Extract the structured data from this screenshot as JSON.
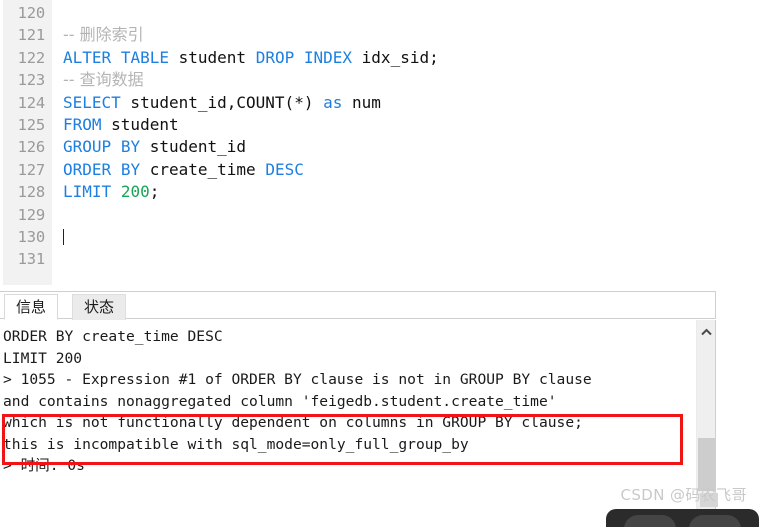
{
  "app": {
    "kind": "sql-client-query-window",
    "watermark": "CSDN @码农飞哥"
  },
  "editor": {
    "first_line_number": 120,
    "cursor_line": 130,
    "line_numbers": [
      "120",
      "121",
      "122",
      "123",
      "124",
      "125",
      "126",
      "127",
      "128",
      "129",
      "130",
      "131"
    ],
    "lines": [
      {
        "n": "120",
        "tokens": []
      },
      {
        "n": "121",
        "tokens": [
          {
            "t": "-- 删除索引",
            "c": "cmt"
          }
        ]
      },
      {
        "n": "122",
        "tokens": [
          {
            "t": "ALTER",
            "c": "kw"
          },
          {
            "t": " ",
            "c": "pln"
          },
          {
            "t": "TABLE",
            "c": "kw"
          },
          {
            "t": " student ",
            "c": "pln"
          },
          {
            "t": "DROP",
            "c": "kw"
          },
          {
            "t": " ",
            "c": "pln"
          },
          {
            "t": "INDEX",
            "c": "kw"
          },
          {
            "t": " idx_sid;",
            "c": "pln"
          }
        ]
      },
      {
        "n": "123",
        "tokens": [
          {
            "t": "-- 查询数据",
            "c": "cmt"
          }
        ]
      },
      {
        "n": "124",
        "tokens": [
          {
            "t": "SELECT",
            "c": "kw"
          },
          {
            "t": " student_id,COUNT(*) ",
            "c": "pln"
          },
          {
            "t": "as",
            "c": "kw"
          },
          {
            "t": " num",
            "c": "pln"
          }
        ]
      },
      {
        "n": "125",
        "tokens": [
          {
            "t": "FROM",
            "c": "kw"
          },
          {
            "t": " student",
            "c": "pln"
          }
        ]
      },
      {
        "n": "126",
        "tokens": [
          {
            "t": "GROUP",
            "c": "kw"
          },
          {
            "t": " ",
            "c": "pln"
          },
          {
            "t": "BY",
            "c": "kw"
          },
          {
            "t": " student_id",
            "c": "pln"
          }
        ]
      },
      {
        "n": "127",
        "tokens": [
          {
            "t": "ORDER",
            "c": "kw"
          },
          {
            "t": " ",
            "c": "pln"
          },
          {
            "t": "BY",
            "c": "kw"
          },
          {
            "t": " create_time ",
            "c": "pln"
          },
          {
            "t": "DESC",
            "c": "kw"
          }
        ]
      },
      {
        "n": "128",
        "tokens": [
          {
            "t": "LIMIT",
            "c": "kw"
          },
          {
            "t": " ",
            "c": "pln"
          },
          {
            "t": "200",
            "c": "num"
          },
          {
            "t": ";",
            "c": "pln"
          }
        ]
      },
      {
        "n": "129",
        "tokens": []
      },
      {
        "n": "130",
        "tokens": [],
        "caret": true
      },
      {
        "n": "131",
        "tokens": []
      }
    ],
    "syntax_colors": {
      "keyword": "#1d7fe0",
      "number": "#18a558",
      "comment": "#b4b4b4",
      "plain": "#111111",
      "gutter_text": "#9a9a9a",
      "gutter_background": "#f2f2f2"
    }
  },
  "tabs": [
    {
      "label": "信息",
      "active": true
    },
    {
      "label": "状态",
      "active": false
    }
  ],
  "output": {
    "lines": [
      "ORDER BY create_time DESC",
      "LIMIT 200",
      "> 1055 - Expression #1 of ORDER BY clause is not in GROUP BY clause",
      "and contains nonaggregated column 'feigedb.student.create_time'",
      "which is not functionally dependent on columns in GROUP BY clause;",
      "this is incompatible with sql_mode=only_full_group_by",
      "> 时间: 0s"
    ],
    "highlight": {
      "color": "#f01414",
      "from_line_index": 4,
      "to_line_index": 5
    }
  },
  "scrollbars": {
    "editor": {
      "orientation": "vertical",
      "arrow_down": "▼",
      "arrow_up": "▲"
    },
    "output": {
      "orientation": "vertical",
      "arrow_up": "▲"
    }
  }
}
